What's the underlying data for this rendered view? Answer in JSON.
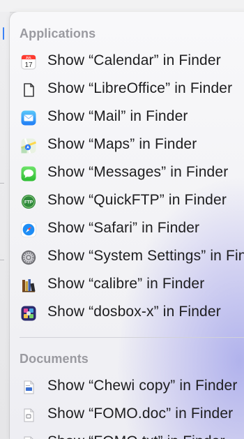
{
  "menu": {
    "sections": [
      {
        "header": "Applications",
        "items": [
          {
            "label": "Show “Calendar” in Finder",
            "icon": "calendar-icon",
            "badge": "17",
            "badge_top": "JUL"
          },
          {
            "label": "Show “LibreOffice” in Finder",
            "icon": "libreoffice-icon"
          },
          {
            "label": "Show “Mail” in Finder",
            "icon": "mail-icon"
          },
          {
            "label": "Show “Maps” in Finder",
            "icon": "maps-icon"
          },
          {
            "label": "Show “Messages” in Finder",
            "icon": "messages-icon"
          },
          {
            "label": "Show “QuickFTP” in Finder",
            "icon": "quickftp-icon",
            "badge": "FTP"
          },
          {
            "label": "Show “Safari” in Finder",
            "icon": "safari-icon"
          },
          {
            "label": "Show “System Settings” in Finder",
            "icon": "system-settings-icon"
          },
          {
            "label": "Show “calibre” in Finder",
            "icon": "calibre-icon"
          },
          {
            "label": "Show “dosbox-x” in Finder",
            "icon": "dosbox-icon"
          }
        ]
      },
      {
        "header": "Documents",
        "items": [
          {
            "label": "Show “Chewi copy” in Finder",
            "icon": "document-icon"
          },
          {
            "label": "Show “FOMO.doc” in Finder",
            "icon": "doc-file-icon"
          },
          {
            "label": "Show “FOMO.txt” in Finder",
            "icon": "text-file-icon"
          }
        ]
      }
    ]
  },
  "colors": {
    "header_text": "#9a9aa0",
    "item_text": "#1d1d1f",
    "accent": "#3b82f6"
  }
}
